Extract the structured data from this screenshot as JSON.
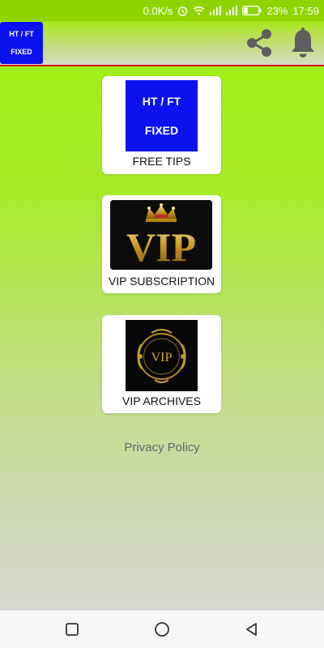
{
  "status_bar": {
    "speed": "0.0K/s",
    "battery": "23%",
    "time": "17:59",
    "icons": [
      "alarm-icon",
      "wifi-icon",
      "signal-icon",
      "signal-icon",
      "battery-icon"
    ]
  },
  "app_bar": {
    "logo_line1": "HT / FT",
    "logo_line2": "FIXED",
    "actions": [
      "share-icon",
      "bell-icon"
    ],
    "divider_color": "#d51b1b"
  },
  "menu": [
    {
      "label": "FREE TIPS",
      "thumb_line1": "HT / FT",
      "thumb_line2": "FIXED"
    },
    {
      "label": "VIP SUBSCRIPTION",
      "thumb_text": "VIP"
    },
    {
      "label": "VIP ARCHIVES",
      "thumb_text": "VIP"
    }
  ],
  "privacy_link": "Privacy Policy",
  "nav_bar": {
    "buttons": [
      "recents-square-icon",
      "home-circle-icon",
      "back-triangle-icon"
    ]
  },
  "colors": {
    "brand_blue": "#0b12ee",
    "accent_green": "#9df20e",
    "gold": "#d4a62a"
  }
}
